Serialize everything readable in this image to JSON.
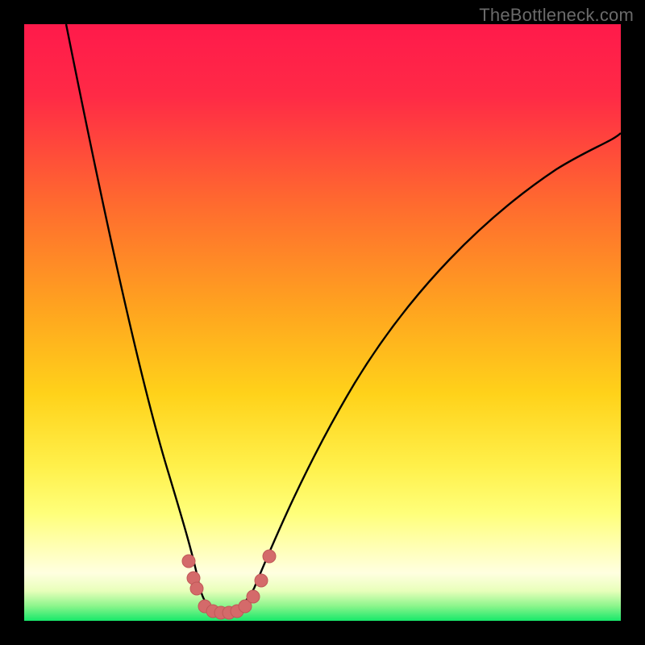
{
  "watermark": {
    "text": "TheBottleneck.com"
  },
  "colors": {
    "frame": "#000000",
    "gradient_top": "#ff1a4b",
    "gradient_mid1": "#ff7a2a",
    "gradient_mid2": "#ffd21a",
    "gradient_mid3": "#ffff6a",
    "gradient_pale": "#ffffc8",
    "gradient_green": "#17e86a",
    "curve_stroke": "#000000",
    "marker_fill": "#d46a6a",
    "marker_stroke": "#c05858"
  },
  "chart_data": {
    "type": "line",
    "title": "",
    "xlabel": "",
    "ylabel": "",
    "xlim": [
      0,
      100
    ],
    "ylim": [
      0,
      100
    ],
    "note": "No axis ticks or labels are visible. Values are estimated from pixel positions: x as percent of plot width, y as percent of plot height (0 = bottom, 100 = top).",
    "series": [
      {
        "name": "bottleneck-curve-left",
        "x": [
          7,
          10,
          13,
          16,
          19,
          22,
          24,
          26,
          27.5,
          28.5,
          29.5
        ],
        "values": [
          100,
          87,
          72,
          58,
          44,
          30,
          20,
          12,
          7,
          4,
          2
        ]
      },
      {
        "name": "bottleneck-curve-trough",
        "x": [
          29.5,
          31,
          33,
          35,
          37,
          38.5
        ],
        "values": [
          2,
          1,
          0.5,
          0.5,
          1,
          2
        ]
      },
      {
        "name": "bottleneck-curve-right",
        "x": [
          38.5,
          41,
          45,
          50,
          56,
          63,
          71,
          80,
          90,
          100
        ],
        "values": [
          2,
          6,
          14,
          24,
          35,
          46,
          57,
          67,
          76,
          82
        ]
      }
    ],
    "markers": {
      "name": "highlighted-points",
      "points": [
        {
          "x": 27.6,
          "y": 10.0
        },
        {
          "x": 28.4,
          "y": 7.2
        },
        {
          "x": 28.9,
          "y": 5.4
        },
        {
          "x": 30.3,
          "y": 2.4
        },
        {
          "x": 31.6,
          "y": 1.6
        },
        {
          "x": 33.0,
          "y": 1.3
        },
        {
          "x": 34.3,
          "y": 1.3
        },
        {
          "x": 35.7,
          "y": 1.6
        },
        {
          "x": 37.0,
          "y": 2.4
        },
        {
          "x": 38.4,
          "y": 4.1
        },
        {
          "x": 39.7,
          "y": 6.8
        },
        {
          "x": 41.1,
          "y": 10.8
        }
      ]
    },
    "gradient_bands_y_percent_from_top": [
      {
        "color": "#ff1a4b",
        "stop": 0
      },
      {
        "color": "#ff7a2a",
        "stop": 38
      },
      {
        "color": "#ffd21a",
        "stop": 62
      },
      {
        "color": "#ffff6a",
        "stop": 80
      },
      {
        "color": "#ffffc8",
        "stop": 90
      },
      {
        "color": "#17e86a",
        "stop": 98
      }
    ]
  }
}
